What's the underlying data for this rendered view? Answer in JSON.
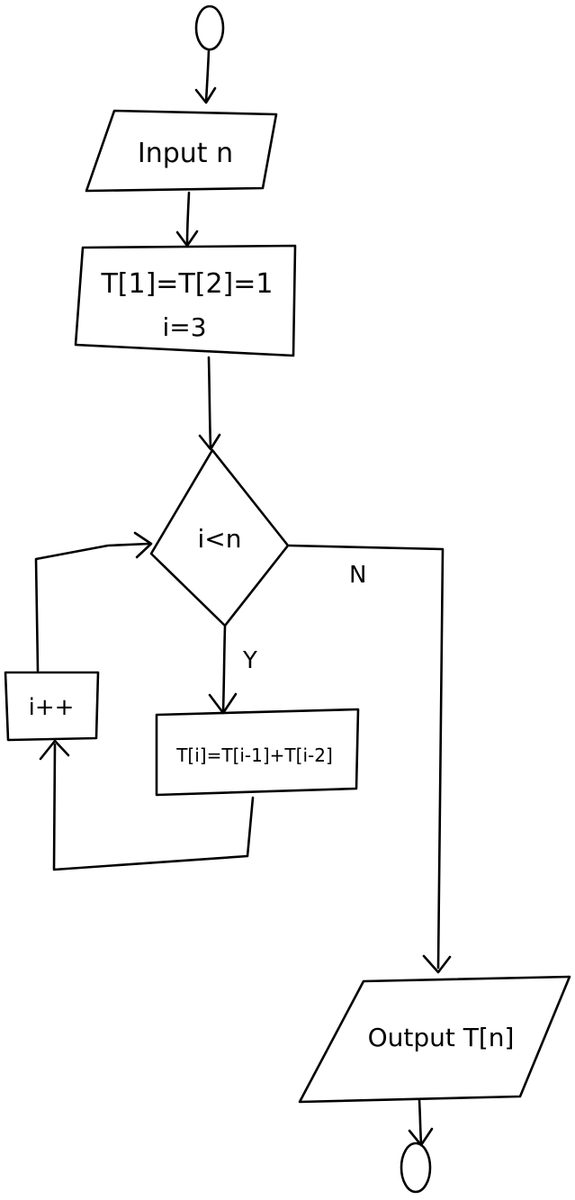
{
  "flowchart": {
    "start_terminal": "",
    "input_label": "Input n",
    "init_line1": "T[1]=T[2]=1",
    "init_line2": "i=3",
    "decision_label": "i<n",
    "yes_label": "Y",
    "no_label": "N",
    "compute_label": "T[i]=T[i-1]+T[i-2]",
    "increment_label": "i++",
    "output_label": "Output T[n]",
    "end_terminal": ""
  },
  "colors": {
    "background": "#ffffff",
    "ink": "#000000"
  }
}
